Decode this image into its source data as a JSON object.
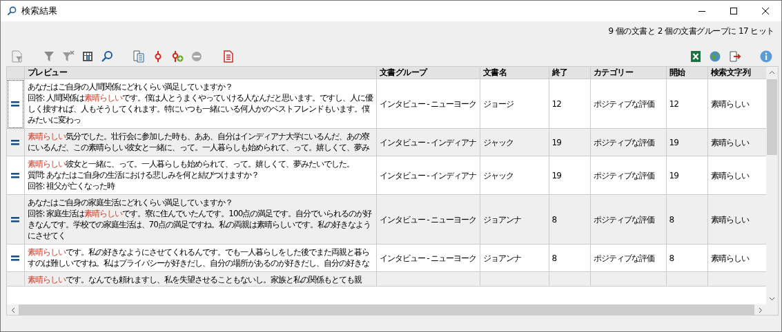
{
  "window": {
    "title": "検索結果"
  },
  "summary": "9 個の文書と 2 個の文書グループに 17 ヒット",
  "table": {
    "preview_column": "プレビュー",
    "columns": [
      "文書グループ",
      "文書名",
      "終了",
      "カテゴリー",
      "開始",
      "検索文字列"
    ],
    "rows": [
      {
        "selected": true,
        "preview": [
          " あなたはご自身の人間関係にどれくらい満足していますか？",
          "回答: 人間関係は**素晴らしい**です。僕は人とうまくやっていける人なんだと思います。ですし、人に優しく接すれば、人もそうしてくれます。特にいつも一緒にいる何人かのベストフレンドもいます。僕みたいに変わっ"
        ],
        "cells": [
          "インタビュー - ニューヨーク",
          "ジョージ",
          "12",
          "ポジティブな評価",
          "12",
          "素晴らしい"
        ]
      },
      {
        "selected": false,
        "preview": [
          "**素晴らしい**気分でした。壮行会に参加した時も、ああ、自分はインディアナ大学にいるんだ、あの寮にいるんだ、この素晴らしい彼女と一緒に、って。一人暮らしも始められて、って。嬉しくて、夢み"
        ],
        "cells": [
          "インタビュー - インディアナ",
          "ジャック",
          "19",
          "ポジティブな評価",
          "19",
          "素晴らしい"
        ]
      },
      {
        "selected": false,
        "preview": [
          "**素晴らしい**彼女と一緒に、って。一人暮らしも始められて、って。嬉しくて、夢みたいでした。",
          "質問: あなたはご自身の生活における悲しみを何と結びつけますか？",
          "回答: 祖父が亡くなった時"
        ],
        "cells": [
          "インタビュー - インディアナ",
          "ジャック",
          "19",
          "ポジティブな評価",
          "19",
          "素晴らしい"
        ]
      },
      {
        "selected": false,
        "preview": [
          " あなたはご自身の家庭生活にどれくらい満足していますか？",
          "回答: 家庭生活は**素晴らしい**です。寮に住んでいたんです。100点の満足です。自分でいられるのが好きなんです。学校での家庭生活は、70点の満足ですね。私の両親は素晴らしいです。私の好きなようにさせてく"
        ],
        "cells": [
          "インタビュー - ニューヨーク",
          "ジョアンナ",
          "8",
          "ポジティブな評価",
          "8",
          "素晴らしい"
        ]
      },
      {
        "selected": false,
        "preview": [
          "**素晴らしい**です。私の好きなようにさせてくれるんです。でも一人暮らしをした後でまた両親と暮らすのは難しいですね。私はプライバシーが好きだし、自分の場所があるのが好きだし、自分の好きな"
        ],
        "cells": [
          "インタビュー - ニューヨーク",
          "ジョアンナ",
          "8",
          "ポジティブな評価",
          "8",
          "素晴らしい"
        ]
      },
      {
        "selected": false,
        "preview": [
          "**素晴らしい**です。なんでも頼れますし、私を失望させることもないし。家族と私の関係もとても親"
        ],
        "cells": []
      }
    ]
  }
}
